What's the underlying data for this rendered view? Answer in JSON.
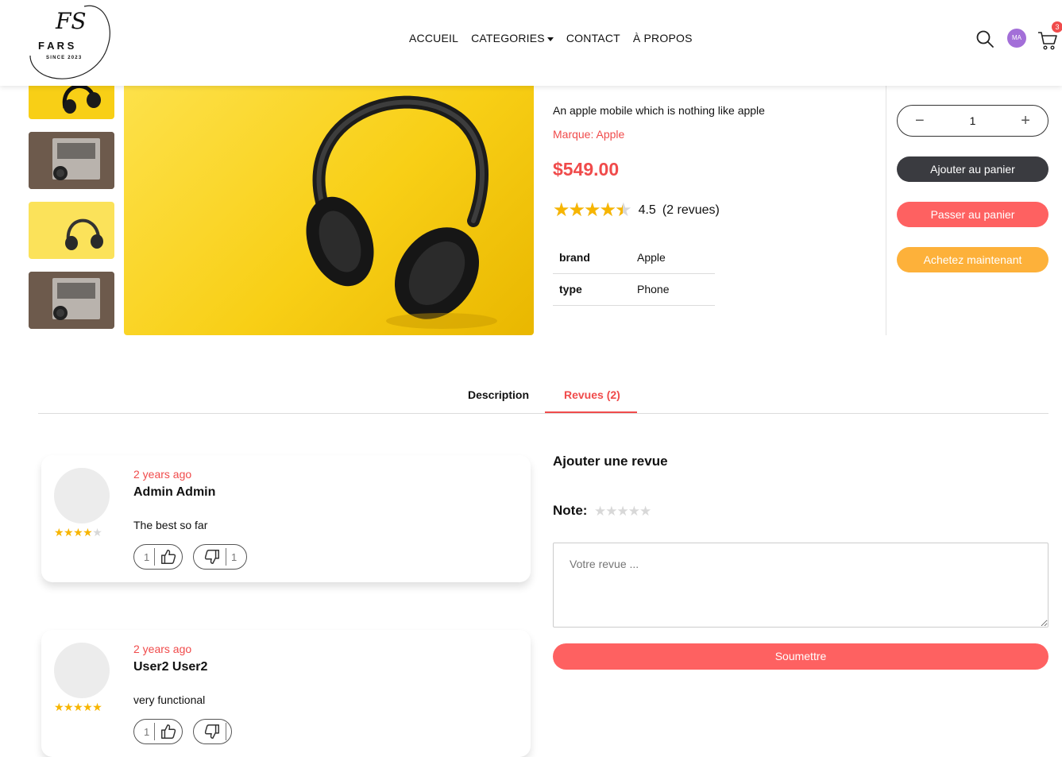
{
  "header": {
    "logo_initials": "FS",
    "logo_name": "F A R S",
    "logo_tagline": "SINCE 2023",
    "nav": [
      "ACCUEIL",
      "CATEGORIES",
      "CONTACT",
      "À PROPOS"
    ],
    "avatar_initials": "MA",
    "cart_count": "3",
    "icons": [
      "search-icon",
      "avatar",
      "cart-icon"
    ]
  },
  "product": {
    "description": "An apple mobile which is nothing like apple",
    "brand_line": "Marque: Apple",
    "price": "$549.00",
    "rating": 4.5,
    "rating_text": "4.5",
    "reviews_text": "(2 revues)",
    "attributes": [
      {
        "key": "brand",
        "value": "Apple"
      },
      {
        "key": "type",
        "value": "Phone"
      }
    ]
  },
  "purchase": {
    "quantity": "1",
    "minus": "−",
    "plus": "+",
    "add_to_cart": "Ajouter au panier",
    "go_to_cart": "Passer au panier",
    "buy_now": "Achetez maintenant"
  },
  "tabs": {
    "description": "Description",
    "reviews": "Revues (2)",
    "active": "reviews"
  },
  "reviews": [
    {
      "time": "2 years ago",
      "name": "Admin Admin",
      "text": "The best so far",
      "stars": 4,
      "likes": "1",
      "dislikes": "1"
    },
    {
      "time": "2 years ago",
      "name": "User2 User2",
      "text": "very functional",
      "stars": 5,
      "likes": "1",
      "dislikes": ""
    }
  ],
  "add_review": {
    "title": "Ajouter une revue",
    "note_label": "Note:",
    "placeholder": "Votre revue ...",
    "submit": "Soumettre"
  },
  "colors": {
    "accent_red": "#f04b4b",
    "dark_button": "#3a3b40",
    "pink_button": "#fe6161",
    "orange_button": "#fdb13a",
    "star": "#f7b500"
  }
}
